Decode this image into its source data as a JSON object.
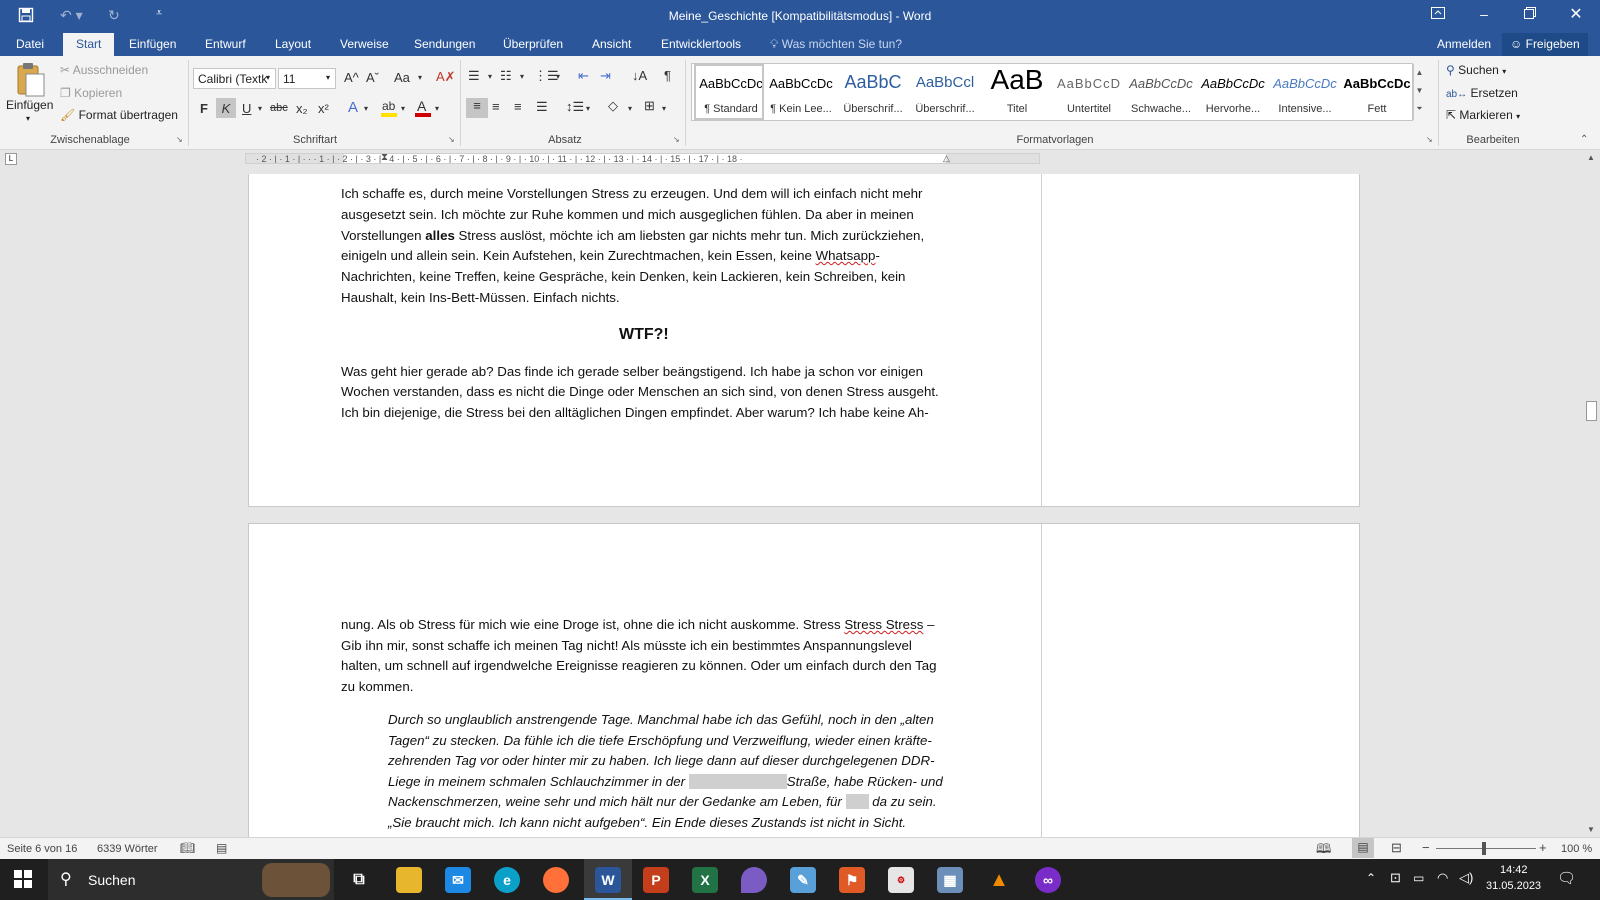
{
  "window": {
    "title": "Meine_Geschichte [Kompatibilitätsmodus] - Word",
    "quick_access": {
      "save_icon": "save-icon",
      "undo_icon": "undo-icon",
      "redo_icon": "redo-icon",
      "customize_icon": "customize-icon"
    },
    "controls": {
      "ribbon_display": "ribbon-display-icon",
      "minimize": "minimize-icon",
      "restore": "restore-icon",
      "close": "close-icon"
    }
  },
  "tabs": [
    "Datei",
    "Start",
    "Einfügen",
    "Entwurf",
    "Layout",
    "Verweise",
    "Sendungen",
    "Überprüfen",
    "Ansicht",
    "Entwicklertools"
  ],
  "tell_me": "Was möchten Sie tun?",
  "sign_in": "Anmelden",
  "share": "Freigeben",
  "clipboard": {
    "paste": "Einfügen",
    "cut": "Ausschneiden",
    "copy": "Kopieren",
    "format_painter": "Format übertragen",
    "group": "Zwischenablage"
  },
  "font": {
    "name": "Calibri (Textk",
    "size": "11",
    "group": "Schriftart",
    "bold": "F",
    "italic": "K",
    "underline": "U",
    "strike": "abc",
    "subscript": "x₂",
    "superscript": "x²",
    "grow": "A^",
    "shrink": "Aˇ",
    "case": "Aa",
    "highlight_color": "#ffe000",
    "font_color": "#d00000"
  },
  "paragraph": {
    "group": "Absatz"
  },
  "styles": {
    "group": "Formatvorlagen",
    "items": [
      {
        "preview": "AaBbCcDc",
        "name": "¶ Standard"
      },
      {
        "preview": "AaBbCcDc",
        "name": "¶ Kein Lee..."
      },
      {
        "preview": "AaBbC",
        "name": "Überschrif..."
      },
      {
        "preview": "AaBbCcl",
        "name": "Überschrif..."
      },
      {
        "preview": "AaB",
        "name": "Titel"
      },
      {
        "preview": "AaBbCcD",
        "name": "Untertitel"
      },
      {
        "preview": "AaBbCcDc",
        "name": "Schwache..."
      },
      {
        "preview": "AaBbCcDc",
        "name": "Hervorhe..."
      },
      {
        "preview": "AaBbCcDc",
        "name": "Intensive..."
      },
      {
        "preview": "AaBbCcDc",
        "name": "Fett"
      }
    ]
  },
  "editing": {
    "find": "Suchen",
    "replace": "Ersetzen",
    "select": "Markieren",
    "group": "Bearbeiten"
  },
  "ruler": {
    "labels": "· 2 · | · 1 · | · ·   · 1 · | · 2 · | · 3 · | · 4 · | · 5 · | · 6 · | · 7 · | · 8 · | · 9 · | · 10 · | · 11 · | · 12 · | · 13 · | · 14 · | · 15 · |   · 17 · | · 18 ·"
  },
  "document": {
    "page1_lines": [
      "Ich schaffe es, durch meine Vorstellungen Stress zu erzeugen. Und dem will ich einfach nicht mehr",
      "ausgesetzt sein. Ich möchte zur Ruhe kommen und mich ausgeglichen fühlen. Da aber in meinen"
    ],
    "line3_before": "Vorstellungen ",
    "line3_bold": "alles",
    "line3_after": " Stress auslöst, möchte ich am liebsten gar nichts mehr tun. Mich zurückziehen,",
    "line4_before": "einigeln und allein sein. Kein Aufstehen, kein Zurechtmachen, kein Essen, keine ",
    "line4_red": "Whatsapp",
    "line4_after": "-",
    "page1_lines_b": [
      "Nachrichten, keine Treffen, keine Gespräche, kein Denken, kein Lackieren, kein Schreiben, kein",
      "Haushalt, kein Ins-Bett-Müssen. Einfach nichts."
    ],
    "heading": "WTF?!",
    "page1_lines_c": [
      "Was geht hier gerade ab? Das finde ich gerade selber beängstigend. Ich habe ja schon vor einigen",
      "Wochen verstanden, dass es nicht die Dinge oder Menschen an sich sind, von denen Stress ausgeht.",
      "Ich bin diejenige, die Stress bei den alltäglichen Dingen empfindet. Aber warum? Ich habe keine Ah-"
    ],
    "p2_line1_before": "nung. Als ob Stress für mich wie eine Droge ist, ohne die ich nicht auskomme. Stress ",
    "p2_line1_red": "Stress Stress",
    "p2_line1_after": " –",
    "page2_lines": [
      "Gib ihn mir, sonst schaffe ich meinen Tag nicht! Als müsste ich ein bestimmtes Anspannungslevel",
      "halten, um schnell auf irgendwelche Ereignisse reagieren zu können. Oder um einfach durch den Tag",
      "zu kommen."
    ],
    "quote_lines": [
      "Durch so unglaublich anstrengende Tage. Manchmal habe ich das Gefühl, noch in den „alten",
      "Tagen“ zu stecken. Da fühle ich die tiefe Erschöpfung und Verzweiflung, wieder einen kräfte-",
      "zehrenden Tag vor oder hinter mir zu haben. Ich liege dann auf dieser durchgelegenen DDR-"
    ],
    "quote4_before": "Liege in meinem schmalen Schlauchzimmer in der ",
    "quote4_after": "Straße, habe Rücken- und",
    "quote5_before": "Nackenschmerzen, weine sehr und mich hält nur der Gedanke am Leben, für ",
    "quote5_after": " da zu sein.",
    "quote6": "„Sie braucht mich. Ich kann nicht aufgeben“. Ein Ende dieses Zustands ist nicht in Sicht."
  },
  "status": {
    "page": "Seite 6 von 16",
    "words": "6339 Wörter",
    "zoom": "100 %",
    "zoom_minus": "−",
    "zoom_plus": "+"
  },
  "taskbar": {
    "search": "Suchen",
    "time": "14:42",
    "date": "31.05.2023",
    "apps": [
      "task-view-icon",
      "file-explorer-icon",
      "mail-icon",
      "edge-icon",
      "firefox-icon",
      "word-icon",
      "powerpoint-icon",
      "excel-icon",
      "affinity-icon",
      "paint-icon",
      "photo-icon",
      "forum-icon",
      "calculator-icon",
      "vlc-icon",
      "overwolf-icon"
    ]
  }
}
